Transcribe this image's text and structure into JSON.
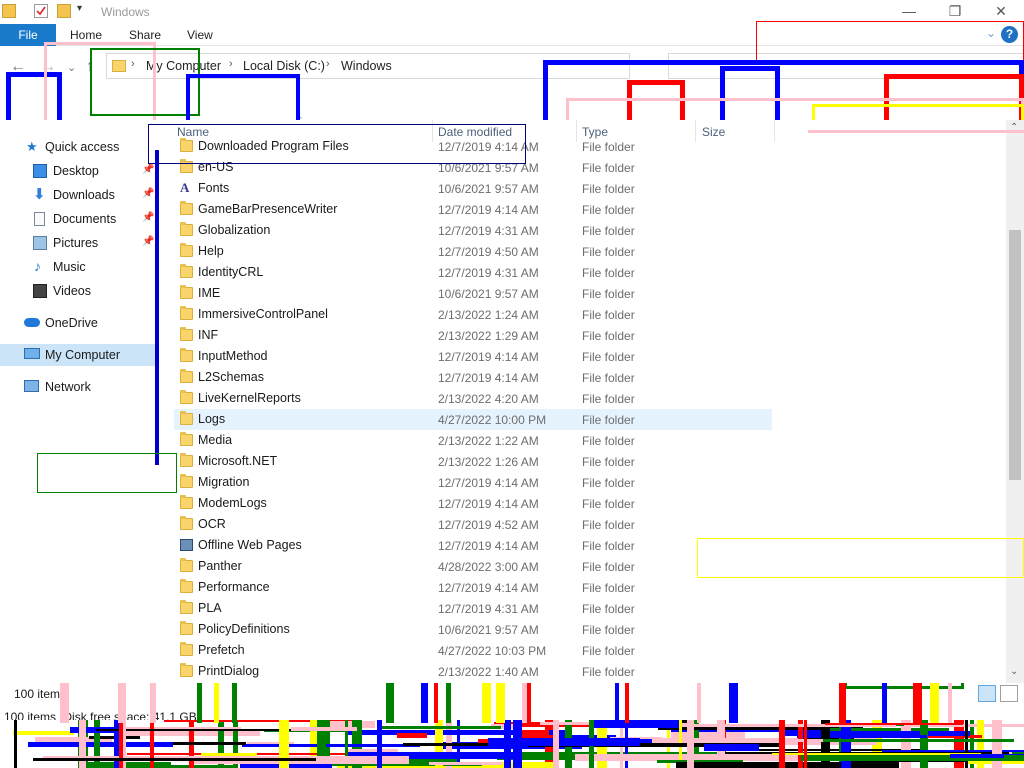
{
  "window": {
    "title": "Windows",
    "controls": [
      "—",
      "❐",
      "✕"
    ]
  },
  "ribbon": {
    "file_label": "File",
    "tabs": [
      "Home",
      "Share",
      "View"
    ]
  },
  "address": {
    "breadcrumb": [
      "My Computer",
      "Local Disk (C:)",
      "Windows"
    ]
  },
  "sidebar": {
    "items": [
      {
        "label": "Quick access",
        "icon": "star-icon"
      },
      {
        "label": "Desktop",
        "icon": "desktop-icon",
        "pinned": true
      },
      {
        "label": "Downloads",
        "icon": "download-icon",
        "pinned": true
      },
      {
        "label": "Documents",
        "icon": "document-icon",
        "pinned": true
      },
      {
        "label": "Pictures",
        "icon": "picture-icon",
        "pinned": true
      },
      {
        "label": "Music",
        "icon": "music-icon"
      },
      {
        "label": "Videos",
        "icon": "video-icon"
      },
      {
        "label": "OneDrive",
        "icon": "cloud-icon"
      },
      {
        "label": "My Computer",
        "icon": "computer-icon",
        "selected": true
      },
      {
        "label": "Network",
        "icon": "network-icon"
      }
    ]
  },
  "columns": {
    "name": "Name",
    "date": "Date modified",
    "type": "Type",
    "size": "Size"
  },
  "files": [
    {
      "name": "Downloaded Program Files",
      "date": "12/7/2019 4:14 AM",
      "type": "File folder",
      "icon": "folder-icon"
    },
    {
      "name": "en-US",
      "date": "10/6/2021 9:57 AM",
      "type": "File folder",
      "icon": "folder-icon"
    },
    {
      "name": "Fonts",
      "date": "10/6/2021 9:57 AM",
      "type": "File folder",
      "icon": "fonts-folder-icon"
    },
    {
      "name": "GameBarPresenceWriter",
      "date": "12/7/2019 4:14 AM",
      "type": "File folder",
      "icon": "folder-icon"
    },
    {
      "name": "Globalization",
      "date": "12/7/2019 4:31 AM",
      "type": "File folder",
      "icon": "folder-icon"
    },
    {
      "name": "Help",
      "date": "12/7/2019 4:50 AM",
      "type": "File folder",
      "icon": "folder-icon"
    },
    {
      "name": "IdentityCRL",
      "date": "12/7/2019 4:31 AM",
      "type": "File folder",
      "icon": "folder-icon"
    },
    {
      "name": "IME",
      "date": "10/6/2021 9:57 AM",
      "type": "File folder",
      "icon": "folder-icon"
    },
    {
      "name": "ImmersiveControlPanel",
      "date": "2/13/2022 1:24 AM",
      "type": "File folder",
      "icon": "folder-icon"
    },
    {
      "name": "INF",
      "date": "2/13/2022 1:29 AM",
      "type": "File folder",
      "icon": "folder-icon"
    },
    {
      "name": "InputMethod",
      "date": "12/7/2019 4:14 AM",
      "type": "File folder",
      "icon": "folder-icon"
    },
    {
      "name": "L2Schemas",
      "date": "12/7/2019 4:14 AM",
      "type": "File folder",
      "icon": "folder-icon"
    },
    {
      "name": "LiveKernelReports",
      "date": "2/13/2022 4:20 AM",
      "type": "File folder",
      "icon": "folder-icon"
    },
    {
      "name": "Logs",
      "date": "4/27/2022 10:00 PM",
      "type": "File folder",
      "icon": "folder-icon",
      "hover": true
    },
    {
      "name": "Media",
      "date": "2/13/2022 1:22 AM",
      "type": "File folder",
      "icon": "folder-icon"
    },
    {
      "name": "Microsoft.NET",
      "date": "2/13/2022 1:26 AM",
      "type": "File folder",
      "icon": "folder-icon"
    },
    {
      "name": "Migration",
      "date": "12/7/2019 4:14 AM",
      "type": "File folder",
      "icon": "folder-icon"
    },
    {
      "name": "ModemLogs",
      "date": "12/7/2019 4:14 AM",
      "type": "File folder",
      "icon": "folder-icon"
    },
    {
      "name": "OCR",
      "date": "12/7/2019 4:52 AM",
      "type": "File folder",
      "icon": "folder-icon"
    },
    {
      "name": "Offline Web Pages",
      "date": "12/7/2019 4:14 AM",
      "type": "File folder",
      "icon": "offline-web-pages-icon"
    },
    {
      "name": "Panther",
      "date": "4/28/2022 3:00 AM",
      "type": "File folder",
      "icon": "folder-icon"
    },
    {
      "name": "Performance",
      "date": "12/7/2019 4:14 AM",
      "type": "File folder",
      "icon": "folder-icon"
    },
    {
      "name": "PLA",
      "date": "12/7/2019 4:31 AM",
      "type": "File folder",
      "icon": "folder-icon"
    },
    {
      "name": "PolicyDefinitions",
      "date": "10/6/2021 9:57 AM",
      "type": "File folder",
      "icon": "folder-icon"
    },
    {
      "name": "Prefetch",
      "date": "4/27/2022 10:03 PM",
      "type": "File folder",
      "icon": "folder-icon"
    },
    {
      "name": "PrintDialog",
      "date": "2/13/2022 1:40 AM",
      "type": "File folder",
      "icon": "folder-icon"
    }
  ],
  "status": {
    "item_count": "100 items",
    "disk_info": "100 items (Disk free space: 41.1 GB)"
  },
  "colors": {
    "accent": "#1979ca",
    "selected_bg": "#cce4f7",
    "hover_bg": "#e5f3ff",
    "overlay_blue": "#0000ff",
    "overlay_red": "#ff0000",
    "overlay_green": "#008000",
    "overlay_pink": "#ffc0cb",
    "overlay_yellow": "#ffff00"
  }
}
